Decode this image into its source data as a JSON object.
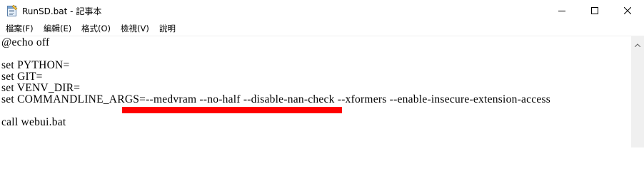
{
  "window": {
    "title": "RunSD.bat - 記事本",
    "icon": "notepad-icon",
    "controls": {
      "minimize": "minimize-icon",
      "maximize": "maximize-icon",
      "close": "close-icon"
    }
  },
  "menu": {
    "items": [
      {
        "label": "檔案(F)"
      },
      {
        "label": "編輯(E)"
      },
      {
        "label": "格式(O)"
      },
      {
        "label": "檢視(V)"
      },
      {
        "label": "說明"
      }
    ]
  },
  "editor": {
    "lines": [
      "@echo off",
      "set PYTHON=",
      "set GIT=",
      "set VENV_DIR=",
      "set COMMANDLINE_ARGS=--medvram --no-half --disable-nan-check --xformers --enable-insecure-extension-access",
      "call webui.bat"
    ],
    "highlight_color": "#ff0000"
  },
  "scrollbar": {
    "up_arrow": "scroll-up-icon"
  }
}
